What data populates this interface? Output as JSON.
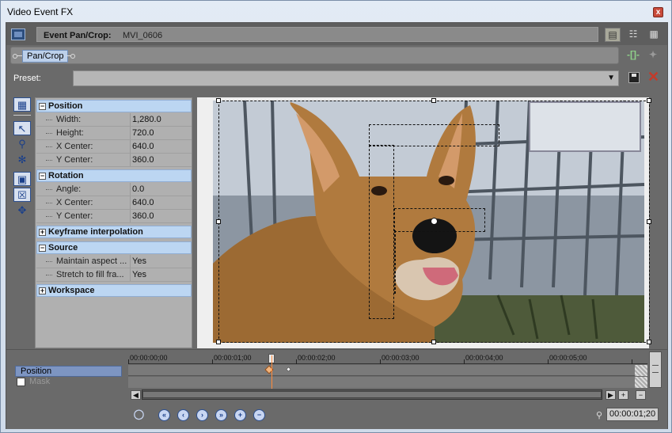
{
  "window": {
    "title": "Video Event FX",
    "close_label": "x"
  },
  "header": {
    "event_label": "Event Pan/Crop:",
    "event_value": "MVI_0606",
    "view_buttons": [
      "grid-single-icon",
      "grid-list-icon",
      "grid-tiles-icon"
    ]
  },
  "chain": {
    "plugin_label": "Pan/Crop"
  },
  "preset": {
    "label": "Preset:",
    "value": ""
  },
  "properties": {
    "position": {
      "label": "Position",
      "rows": [
        {
          "name": "Width:",
          "value": "1,280.0"
        },
        {
          "name": "Height:",
          "value": "720.0"
        },
        {
          "name": "X Center:",
          "value": "640.0"
        },
        {
          "name": "Y Center:",
          "value": "360.0"
        }
      ]
    },
    "rotation": {
      "label": "Rotation",
      "rows": [
        {
          "name": "Angle:",
          "value": "0.0"
        },
        {
          "name": "X Center:",
          "value": "640.0"
        },
        {
          "name": "Y Center:",
          "value": "360.0"
        }
      ]
    },
    "keyframe": {
      "label": "Keyframe interpolation"
    },
    "source": {
      "label": "Source",
      "rows": [
        {
          "name": "Maintain aspect ...",
          "value": "Yes"
        },
        {
          "name": "Stretch to fill fra...",
          "value": "Yes"
        }
      ]
    },
    "workspace": {
      "label": "Workspace"
    }
  },
  "timeline": {
    "tracks": [
      "Position",
      "Mask"
    ],
    "ruler": [
      "00:00:00;00",
      "00:00:01;00",
      "00:00:02;00",
      "00:00:03;00",
      "00:00:04;00",
      "00:00:05;00"
    ],
    "current_time": "00:00:01;20"
  }
}
